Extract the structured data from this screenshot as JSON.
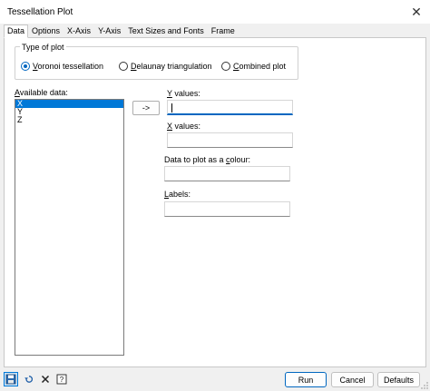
{
  "window": {
    "title": "Tessellation Plot",
    "close_glyph": "✕"
  },
  "tabs": [
    {
      "label": "Data",
      "active": true
    },
    {
      "label": "Options"
    },
    {
      "label": "X-Axis"
    },
    {
      "label": "Y-Axis"
    },
    {
      "label": "Text Sizes and Fonts"
    },
    {
      "label": "Frame"
    }
  ],
  "plot_type": {
    "title": "Type of plot",
    "options": [
      {
        "mn": "V",
        "rest": "oronoi tessellation",
        "checked": true
      },
      {
        "mn": "D",
        "rest": "elaunay triangulation",
        "checked": false
      },
      {
        "mn": "C",
        "rest": "ombined plot",
        "checked": false
      }
    ]
  },
  "available": {
    "mn": "A",
    "rest": "vailable data:",
    "items": [
      "X",
      "Y",
      "Z"
    ],
    "selected_index": 0
  },
  "arrow_label": "->",
  "fields": {
    "y_values": {
      "mn": "Y",
      "rest": " values:",
      "value": ""
    },
    "x_values": {
      "mn": "X",
      "rest": " values:",
      "value": ""
    },
    "colour": {
      "pre": "Data to plot as a ",
      "mn": "c",
      "rest": "olour:",
      "value": ""
    },
    "labels": {
      "mn": "L",
      "rest": "abels:",
      "value": ""
    }
  },
  "buttons": {
    "run": "Run",
    "cancel": "Cancel",
    "defaults": "Defaults"
  },
  "icons": [
    "save-icon",
    "restore-icon",
    "clear-icon",
    "help-icon"
  ],
  "colors": {
    "accent": "#0067c0",
    "selection": "#0078d7"
  }
}
